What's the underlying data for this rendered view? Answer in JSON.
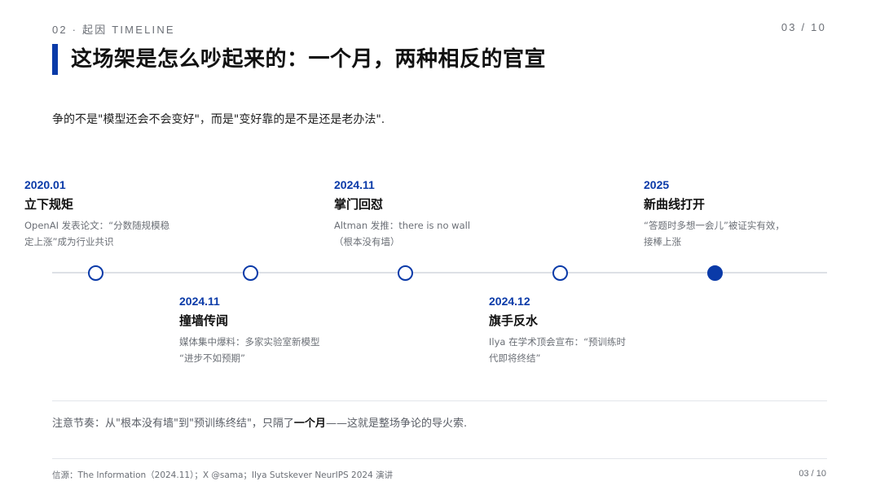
{
  "header": {
    "section_label": "02 · 起因 TIMELINE",
    "page_counter": "03 / 10"
  },
  "title": "这场架是怎么吵起来的：一个月，两种相反的官宣",
  "subtitle": "争的不是\"模型还会不会变好\"，而是\"变好靠的是不是还是老办法\".",
  "timeline": {
    "events": [
      {
        "date": "2020.01",
        "name": "立下规矩",
        "desc": [
          "OpenAI 发表论文：“分数随规模稳",
          "定上涨”成为行业共识"
        ]
      },
      {
        "date": "2024.11",
        "name": "撞墙传闻",
        "desc": [
          "媒体集中爆料：多家实验室新模型",
          "“进步不如预期”"
        ]
      },
      {
        "date": "2024.11",
        "name": "掌门回怼",
        "desc": [
          "Altman 发推：there is no wall",
          "（根本没有墙）"
        ]
      },
      {
        "date": "2024.12",
        "name": "旗手反水",
        "desc": [
          "Ilya 在学术顶会宣布：“预训练时",
          "代即将终结”"
        ]
      },
      {
        "date": "2025",
        "name": "新曲线打开",
        "desc": [
          "“答题时多想一会儿”被证实有效，",
          "接棒上涨"
        ]
      }
    ]
  },
  "note": {
    "prefix": "注意节奏：从\"根本没有墙\"到\"预训练终结\"，只隔了",
    "emphasis": "一个月",
    "suffix": "——这就是整场争论的导火索."
  },
  "footer": {
    "source": "信源：The Information（2024.11）；X @sama；Ilya Sutskever NeurIPS 2024 演讲",
    "page_counter": "03 / 10"
  },
  "colors": {
    "accent": "#0a3aa8",
    "line": "#dde0e6",
    "muted": "#6b6f76"
  }
}
